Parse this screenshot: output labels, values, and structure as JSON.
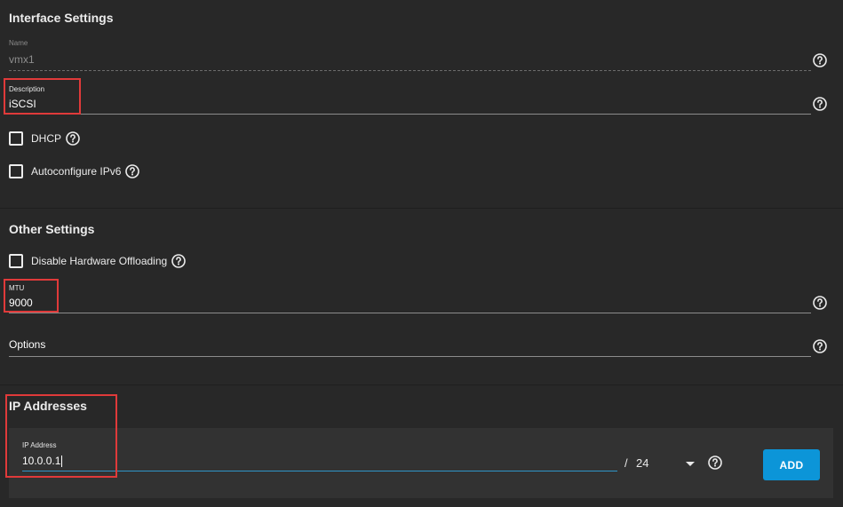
{
  "interface_settings": {
    "title": "Interface Settings",
    "name": {
      "label": "Name",
      "value": "vmx1"
    },
    "description": {
      "label": "Description",
      "value": "iSCSI"
    },
    "dhcp": {
      "label": "DHCP",
      "checked": false
    },
    "autoconfigure_ipv6": {
      "label": "Autoconfigure IPv6",
      "checked": false
    }
  },
  "other_settings": {
    "title": "Other Settings",
    "disable_hw_offloading": {
      "label": "Disable Hardware Offloading",
      "checked": false
    },
    "mtu": {
      "label": "MTU",
      "value": "9000"
    },
    "options": {
      "label": "Options",
      "value": ""
    }
  },
  "ip_addresses": {
    "title": "IP Addresses",
    "ip_address": {
      "label": "IP Address",
      "value": "10.0.0.1"
    },
    "netmask": {
      "separator": "/",
      "value": "24"
    },
    "add_label": "ADD"
  },
  "icons": {
    "help": "help-circle-icon",
    "dropdown": "chevron-down-icon"
  },
  "colors": {
    "background": "#282828",
    "card": "#323232",
    "accent": "#0c95d8",
    "highlight": "#e03a3a"
  }
}
